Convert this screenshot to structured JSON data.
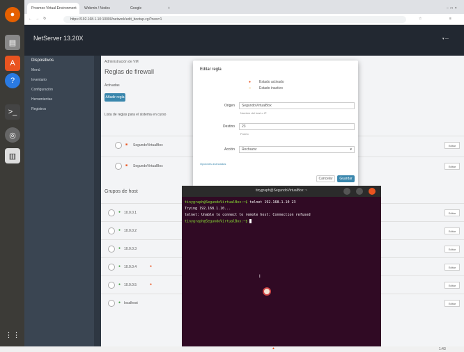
{
  "browser": {
    "tabs": [
      {
        "label": "Proxmox Virtual Environment"
      },
      {
        "label": "Webmin / Nodes"
      },
      {
        "label": "Google"
      }
    ],
    "address": "https://192.168.1.10:10000/network/edit_bootup.cgi?new=1"
  },
  "app": {
    "title": "NetServer 13.20X"
  },
  "sidebar": {
    "header": "Dispositivos",
    "items": [
      {
        "label": "Menú"
      },
      {
        "label": "Inventario"
      },
      {
        "label": "Configuración"
      },
      {
        "label": "Herramientas"
      },
      {
        "label": "Registros"
      }
    ]
  },
  "main": {
    "breadcrumb": "Administración de VM",
    "title": "Reglas de firewall",
    "section_label": "Activadas",
    "add_button": "Añadir regla",
    "list_caption": "Lista de reglas para el sistema en curso",
    "groups_label": "Grupos de host",
    "vm_rows": [
      {
        "label": "SegundoVirtualBox",
        "action": "Editar"
      },
      {
        "label": "SegundoVirtualBox",
        "action": "Editar"
      }
    ],
    "host_rows": [
      {
        "label": "10.0.0.1",
        "action": "Editar"
      },
      {
        "label": "10.0.0.2",
        "action": "Editar"
      },
      {
        "label": "10.0.0.3",
        "action": "Editar"
      },
      {
        "label": "10.0.0.4",
        "action": "Editar"
      },
      {
        "label": "10.0.0.5",
        "action": "Editar"
      },
      {
        "label": "localhost",
        "action": "Editar"
      }
    ]
  },
  "dialog": {
    "title": "Editar regla",
    "options": [
      "Estado activado",
      "Estado inactivo"
    ],
    "origin_label": "Origen",
    "origin_value": "SegundoVirtualBox",
    "origin_hint": "Nombre del host o IP",
    "dest_label": "Destino",
    "dest_value": "23",
    "dest_hint": "Puerto",
    "action_label": "Acción",
    "action_value": "Rechazar",
    "advanced_link": "Opciones avanzadas",
    "cancel": "Cancelar",
    "save": "Guardar"
  },
  "terminal": {
    "title": "tinygraph@SegundoVirtualBox: ~",
    "lines": [
      {
        "prompt": "tinygraph@SegundoVirtualBox:~$",
        "cmd": " telnet 192.168.1.10 23"
      },
      {
        "prompt": "",
        "cmd": "Trying 192.168.1.10..."
      },
      {
        "prompt": "",
        "cmd": "telnet: Unable to connect to remote host: Connection refused"
      },
      {
        "prompt": "tinygraph@SegundoVirtualBox:~$",
        "cmd": " "
      }
    ]
  },
  "system": {
    "clock": "1:43"
  }
}
